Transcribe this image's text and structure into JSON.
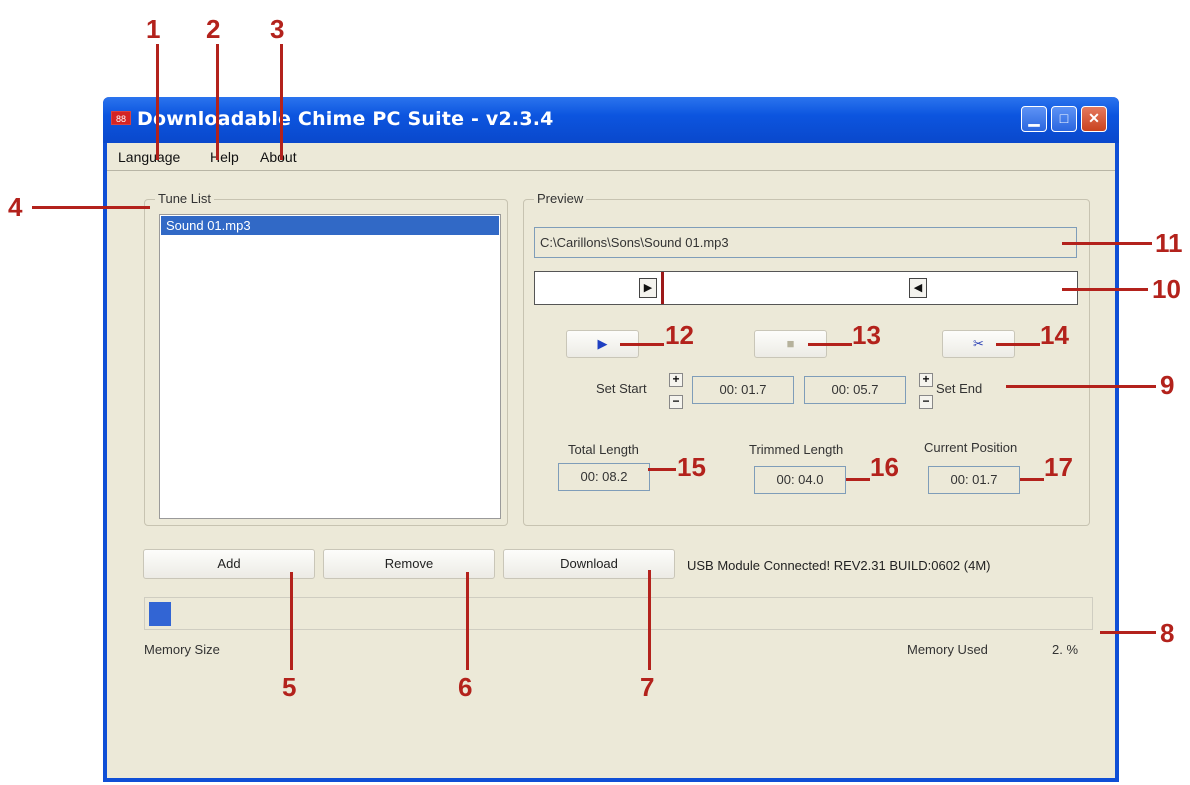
{
  "window": {
    "title": "Downloadable Chime PC Suite  - v2.3.4",
    "app_icon_text": "88"
  },
  "menu": {
    "items": [
      "Language",
      "Help",
      "About"
    ]
  },
  "tune_list": {
    "label": "Tune List",
    "items": [
      "Sound 01.mp3"
    ]
  },
  "preview": {
    "label": "Preview",
    "file_path": "C:\\Carillons\\Sons\\Sound 01.mp3",
    "set_start_label": "Set Start",
    "start_time": "00: 01.7",
    "end_time": "00: 05.7",
    "set_end_label": "Set End",
    "total_length_label": "Total Length",
    "total_length": "00: 08.2",
    "trimmed_length_label": "Trimmed Length",
    "trimmed_length": "00: 04.0",
    "current_position_label": "Current Position",
    "current_position": "00: 01.7"
  },
  "buttons": {
    "add": "Add",
    "remove": "Remove",
    "download": "Download"
  },
  "status": "USB Module Connected! REV2.31 BUILD:0602 (4M)",
  "memory": {
    "size_label": "Memory Size",
    "used_label": "Memory Used",
    "used_value": "2. %",
    "used_fraction": 0.02
  },
  "callouts": [
    "1",
    "2",
    "3",
    "4",
    "5",
    "6",
    "7",
    "8",
    "9",
    "10",
    "11",
    "12",
    "13",
    "14",
    "15",
    "16",
    "17"
  ],
  "colors": {
    "titlebar": "#0c55df",
    "selection": "#3169c6",
    "callout": "#b3221c",
    "progress": "#3265d4"
  }
}
